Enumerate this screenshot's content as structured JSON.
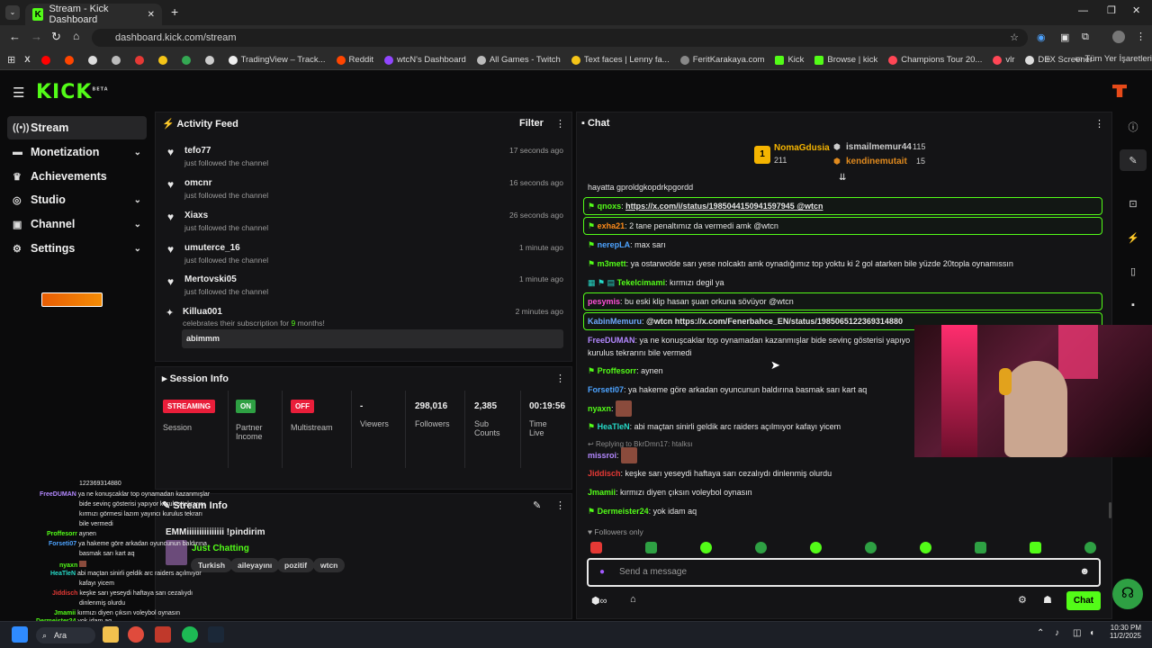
{
  "browser": {
    "tab_title": "Stream - Kick Dashboard",
    "url": "dashboard.kick.com/stream",
    "bookmarks": [
      "TradingView – Track...",
      "Reddit",
      "wtcN's Dashboard",
      "All Games - Twitch",
      "Text faces | Lenny fa...",
      "FeritKarakaya.com",
      "Kick",
      "Browse | kick",
      "Champions Tour 20...",
      "vlr",
      "DEX Screener"
    ],
    "bookmarks_folder": "Tüm Yer İşaretleri"
  },
  "app": {
    "logo": "KICK",
    "logo_badge": "BETA"
  },
  "sidebar": [
    {
      "label": "Stream",
      "icon": "stream-icon"
    },
    {
      "label": "Monetization",
      "icon": "money-icon"
    },
    {
      "label": "Achievements",
      "icon": "trophy-icon"
    },
    {
      "label": "Studio",
      "icon": "studio-icon"
    },
    {
      "label": "Channel",
      "icon": "channel-icon"
    },
    {
      "label": "Settings",
      "icon": "gear-icon"
    }
  ],
  "activity": {
    "title": "Activity Feed",
    "filter": "Filter",
    "items": [
      {
        "name": "tefo77",
        "action": "just followed the channel",
        "time": "17 seconds ago"
      },
      {
        "name": "omcnr",
        "action": "just followed the channel",
        "time": "16 seconds ago"
      },
      {
        "name": "Xiaxs",
        "action": "just followed the channel",
        "time": "26 seconds ago"
      },
      {
        "name": "umuterce_16",
        "action": "just followed the channel",
        "time": "1 minute ago"
      },
      {
        "name": "Mertovski05",
        "action": "just followed the channel",
        "time": "1 minute ago"
      },
      {
        "name": "Killua001",
        "action_pre": "celebrates their subscription for ",
        "months": "9",
        "action_post": " months!",
        "time": "2 minutes ago",
        "message": "abimmm"
      }
    ]
  },
  "session": {
    "title": "Session Info",
    "stats": [
      {
        "badge": "STREAMING",
        "badge_color": "#e91e3a",
        "label": "Session"
      },
      {
        "badge": "ON",
        "badge_color": "#2ea043",
        "label": "Partner Income"
      },
      {
        "badge": "OFF",
        "badge_color": "#e91e3a",
        "label": "Multistream"
      },
      {
        "value": "-",
        "label": "Viewers"
      },
      {
        "value": "298,016",
        "label": "Followers"
      },
      {
        "value": "2,385",
        "label": "Sub Counts"
      },
      {
        "value": "00:19:56",
        "label": "Time Live"
      }
    ]
  },
  "stream_info": {
    "title": "Stream Info",
    "stream_title": "EMMiiiiiiiiiiiiiii !pindirim",
    "category": "Just Chatting",
    "tags": [
      "Turkish",
      "aileyayını",
      "pozitif",
      "wtcn"
    ]
  },
  "chat": {
    "title": "Chat",
    "leaderboard": [
      {
        "rank": "1",
        "name": "NomaGdusia",
        "count": "211"
      },
      {
        "name": "ismailmemur44",
        "count": "115"
      },
      {
        "name": "kendinemutait",
        "count": "15"
      }
    ],
    "messages": [
      {
        "user": "",
        "text": "hayatta gproldgkopdrkpgordd",
        "color": "#e6e6e6"
      },
      {
        "user": "qnoxs",
        "text": "https://x.com/i/status/1985044150941597945 @wtcn",
        "color": "#53fc18",
        "hl": true
      },
      {
        "user": "exha21",
        "text": "2 tane penaltımız da vermedi amk @wtcn",
        "color": "#ff8c1a",
        "hl": true
      },
      {
        "user": "nerepLA",
        "text": "max sarı",
        "color": "#4da3ff"
      },
      {
        "user": "m3mett",
        "text": "ya ostarwolde sarı yese nolcaktı amk oynadığımız top yoktu ki 2 gol atarken bile yüzde 20topla oynamıssın",
        "color": "#53fc18"
      },
      {
        "user": "Tekelcimami",
        "text": "kırmızı degil ya",
        "color": "#53fc18"
      },
      {
        "user": "pesymis",
        "text": "bu eski klip hasan şuan orkuna sövüyor @wtcn",
        "color": "#ff4fd8",
        "hl": true
      },
      {
        "user": "KabinMemuru",
        "text": "@wtcn https://x.com/Fenerbahce_EN/status/1985065122369314880",
        "color": "#6fa8ff",
        "hl": true
      },
      {
        "user": "FreeDUMAN",
        "text": "ya ne konuşcaklar top oynamadan kazanmışlar bide sevinç gösterisi yapıyo",
        "color": "#b388ff",
        "text2": "kurulus tekrarını bile vermedi"
      },
      {
        "user": "Proffesorr",
        "text": "aynen",
        "color": "#53fc18"
      },
      {
        "user": "Forseti07",
        "text": "ya hakeme göre arkadan oyuncunun baldırına basmak sarı kart aq",
        "color": "#4da3ff"
      },
      {
        "user": "nyaxn",
        "text": "",
        "color": "#53fc18"
      },
      {
        "user": "HeaTleN",
        "text": "abi maçtan sinirli geldik arc raiders açılmıyor kafayı yicem",
        "color": "#26d9c7"
      },
      {
        "user": "missroi",
        "text": "",
        "color": "#b388ff",
        "reply": "Replying to BkrDmn17: htalksı"
      },
      {
        "user": "Jiddisch",
        "text": "keşke sarı yeseydi haftaya sarı cezalıydı dinlenmiş olurdu",
        "color": "#e53935"
      },
      {
        "user": "Jmamii",
        "text": "kırmızı diyen çıksın voleybol oynasın",
        "color": "#53fc18"
      },
      {
        "user": "Dermeister24",
        "text": "yok idam aq",
        "color": "#53fc18"
      }
    ],
    "mode": "Followers only",
    "placeholder": "Send a message",
    "send": "Chat"
  },
  "overlay": [
    {
      "user": "",
      "text": "122369314880"
    },
    {
      "user": "FreeDUMAN",
      "text": "ya ne konuşcaklar top oynamadan kazanmışlar"
    },
    {
      "user": "",
      "text": "bide sevinç gösterisi yapıyor kurulus tekrarını"
    },
    {
      "user": "",
      "text": "kırmızı görmesi lazım yayıncı kurulus tekrarı"
    },
    {
      "user": "",
      "text": "bile vermedi"
    },
    {
      "user": "Proffesorr",
      "text": "aynen"
    },
    {
      "user": "Forseti07",
      "text": "ya hakeme göre arkadan oyuncunun baldırına"
    },
    {
      "user": "",
      "text": "basmak sarı kart aq"
    },
    {
      "user": "nyaxn",
      "text": ""
    },
    {
      "user": "HeaTleN",
      "text": "abi maçtan sinirli geldik arc raiders açılmıyor"
    },
    {
      "user": "",
      "text": "kafayı yicem"
    },
    {
      "user": "Jiddisch",
      "text": "keşke sarı yeseydi haftaya sarı cezalıydı"
    },
    {
      "user": "",
      "text": "dinlenmiş olurdu"
    },
    {
      "user": "Jmamii",
      "text": "kırmızı diyen çıksın voleybol oynasın"
    },
    {
      "user": "Dermeister24",
      "text": "yok idam aq"
    }
  ],
  "taskbar": {
    "search": "Ara",
    "time": "10:30 PM",
    "date": "11/2/2025"
  }
}
